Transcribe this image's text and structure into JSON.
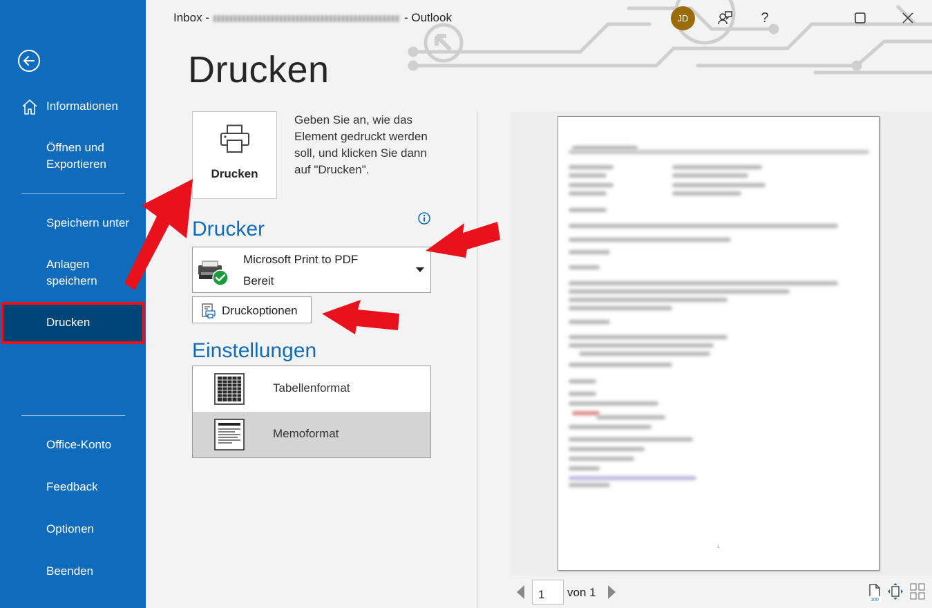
{
  "window": {
    "title_prefix": "Inbox -",
    "title_suffix": "-  Outlook",
    "avatar_initials": "JD",
    "help_label": "?"
  },
  "sidebar": {
    "items": [
      {
        "label": "Informationen",
        "icon": "home-icon"
      },
      {
        "label": "Öffnen und Exportieren"
      },
      {
        "label": "Speichern unter"
      },
      {
        "label": "Anlagen speichern"
      },
      {
        "label": "Drucken",
        "active": true
      },
      {
        "label": "Office-Konto"
      },
      {
        "label": "Feedback"
      },
      {
        "label": "Optionen"
      },
      {
        "label": "Beenden"
      }
    ]
  },
  "main": {
    "page_title": "Drucken",
    "print_button_label": "Drucken",
    "print_description": "Geben Sie an, wie das Element gedruckt werden soll, und klicken Sie dann auf \"Drucken\".",
    "printer_section_title": "Drucker",
    "printer_name": "Microsoft Print to PDF",
    "printer_status": "Bereit",
    "print_options_label": "Druckoptionen",
    "settings_section_title": "Einstellungen",
    "settings": [
      {
        "label": "Tabellenformat",
        "selected": false
      },
      {
        "label": "Memoformat",
        "selected": true
      }
    ]
  },
  "preview": {
    "current_page": "1",
    "of_label": "von 1",
    "page_number_marker": "1"
  },
  "colors": {
    "sidebar_bg": "#0f6cbd",
    "sidebar_active": "#004578",
    "accent": "#0f6cbd",
    "highlight_red": "#e8111c"
  }
}
